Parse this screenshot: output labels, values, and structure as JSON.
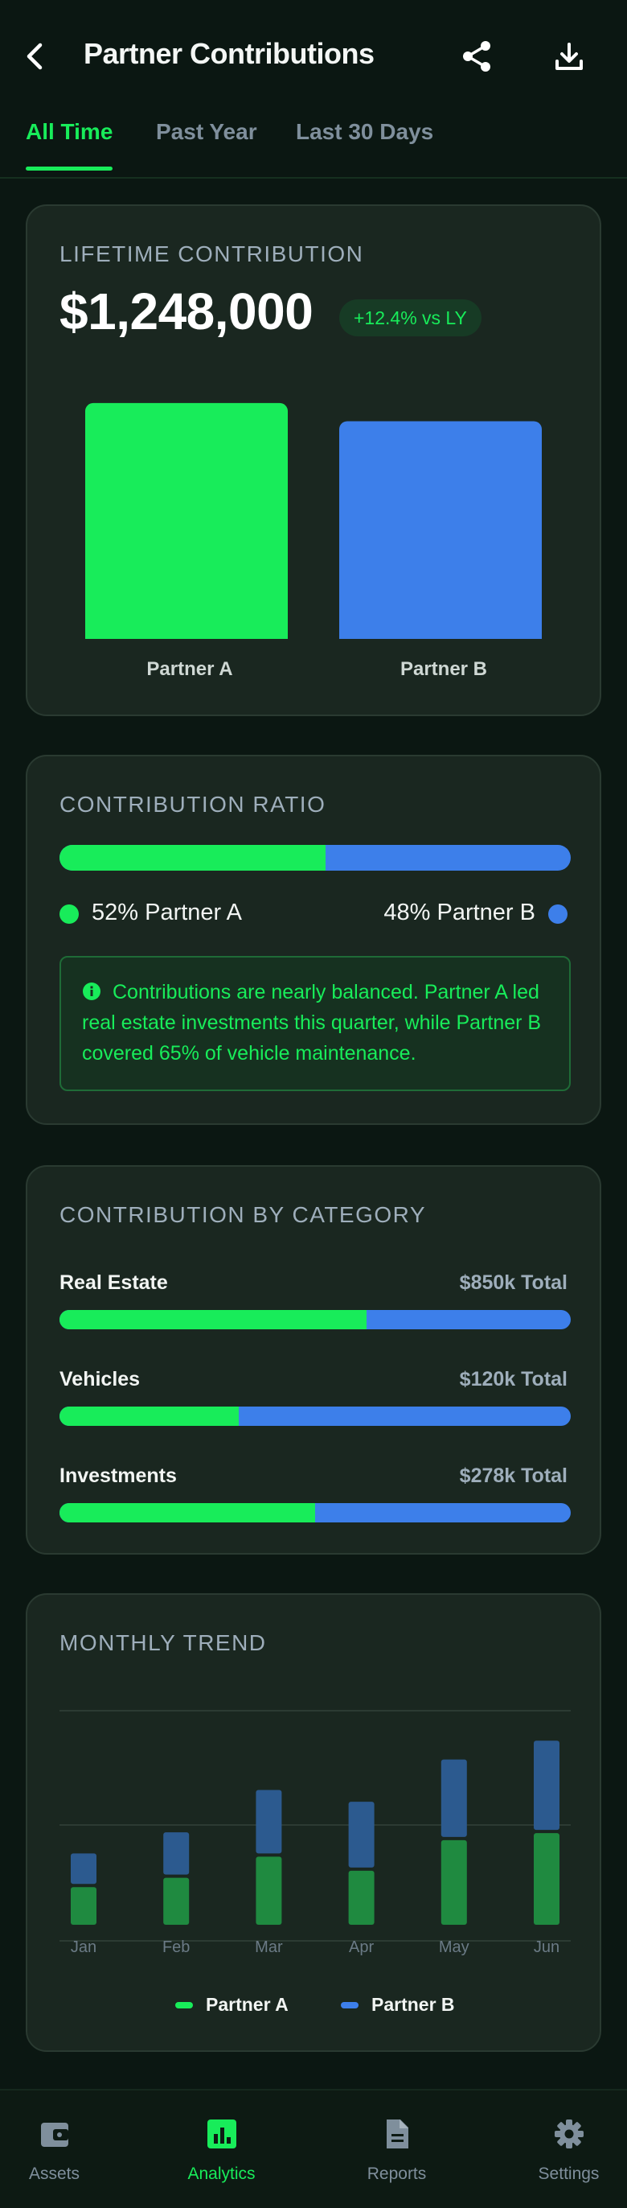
{
  "header": {
    "title": "Partner Contributions",
    "back_icon": "chevron-left-icon",
    "share_icon": "share-icon",
    "download_icon": "download-icon"
  },
  "tabs": [
    {
      "label": "All Time",
      "active": true
    },
    {
      "label": "Past Year",
      "active": false
    },
    {
      "label": "Last 30 Days",
      "active": false
    }
  ],
  "lifetime": {
    "label": "LIFETIME CONTRIBUTION",
    "amount": "$1,248,000",
    "delta": "+12.4% vs LY",
    "chart_data": {
      "type": "bar",
      "categories": [
        "Partner A",
        "Partner B"
      ],
      "values": [
        52,
        48
      ],
      "colors": [
        "#18ec5a",
        "#3d7fea"
      ]
    }
  },
  "ratio": {
    "label": "CONTRIBUTION RATIO",
    "partner_a_share": 52,
    "partner_a_text": "52% Partner A",
    "partner_b_text": "48% Partner B",
    "note": "Contributions are nearly balanced. Partner A led real estate investments this quarter, while Partner B covered 65% of vehicle maintenance.",
    "note_icon": "info-icon"
  },
  "categories": {
    "label": "CONTRIBUTION BY CATEGORY",
    "items": [
      {
        "name": "Real Estate",
        "total": "$850k Total",
        "partner_a_fraction": 0.6
      },
      {
        "name": "Vehicles",
        "total": "$120k Total",
        "partner_a_fraction": 0.35
      },
      {
        "name": "Investments",
        "total": "$278k Total",
        "partner_a_fraction": 0.5
      }
    ]
  },
  "trend": {
    "label": "MONTHLY TREND",
    "legend_a": "Partner A",
    "legend_b": "Partner B",
    "chart_data": {
      "type": "bar",
      "categories": [
        "Jan",
        "Feb",
        "Mar",
        "Apr",
        "May",
        "Jun"
      ],
      "series": [
        {
          "name": "Partner A",
          "values": [
            32,
            40,
            58,
            46,
            72,
            78
          ],
          "color": "#1f8a40"
        },
        {
          "name": "Partner B",
          "values": [
            26,
            36,
            54,
            56,
            66,
            76
          ],
          "color": "#2c5a8f"
        }
      ],
      "ylim": [
        0,
        185
      ],
      "grid": true
    }
  },
  "colors": {
    "partner_a": "#18ec5a",
    "partner_b": "#3d7fea",
    "background": "#0b1712",
    "card": "#1a2720"
  },
  "nav": [
    {
      "label": "Assets",
      "icon": "wallet-icon",
      "active": false
    },
    {
      "label": "Analytics",
      "icon": "analytics-icon",
      "active": true
    },
    {
      "label": "Reports",
      "icon": "document-icon",
      "active": false
    },
    {
      "label": "Settings",
      "icon": "gear-icon",
      "active": false
    }
  ]
}
